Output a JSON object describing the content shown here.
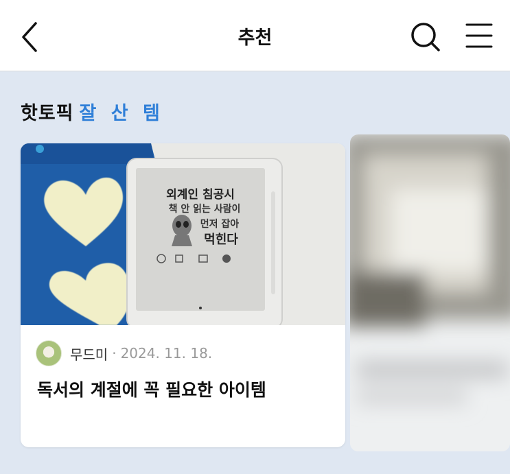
{
  "header": {
    "title": "추천"
  },
  "section": {
    "title": "핫토픽",
    "accent": "잘 산 템"
  },
  "cards": [
    {
      "author": "무드미",
      "separator": "·",
      "date": "2024. 11. 18.",
      "title": "독서의 계절에 꼭 필요한 아이템",
      "image": {
        "ereader_lines": [
          "외계인 침공시",
          "책 안 읽는 사람이",
          "먼저 잡아",
          "먹힌다"
        ]
      }
    }
  ],
  "colors": {
    "accent": "#2f7fd8",
    "background": "#dfe7f2",
    "card": "#ffffff"
  }
}
